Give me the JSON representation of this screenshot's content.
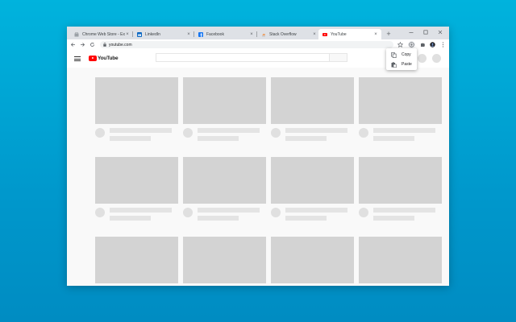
{
  "browser": {
    "tabs": [
      {
        "label": "Chrome Web Store - Exte",
        "favicon": "chrome-web-store-icon",
        "active": false
      },
      {
        "label": "LinkedIn",
        "favicon": "linkedin-icon",
        "active": false
      },
      {
        "label": "Facebook",
        "favicon": "facebook-icon",
        "active": false
      },
      {
        "label": "Stack Overflow",
        "favicon": "stack-overflow-icon",
        "active": false
      },
      {
        "label": "YouTube",
        "favicon": "youtube-icon",
        "active": true
      }
    ],
    "tab_close_glyph": "×",
    "new_tab_glyph": "+",
    "address": "youtube.com"
  },
  "extension_menu": {
    "items": [
      {
        "label": "Copy",
        "icon": "copy-icon"
      },
      {
        "label": "Paste",
        "icon": "paste-icon"
      }
    ]
  },
  "youtube": {
    "logo_text": "YouTube",
    "brand_color": "#ff0000"
  },
  "colors": {
    "desktop_top": "#00b3dd",
    "desktop_bottom": "#008cc2",
    "placeholder": "#d3d3d3"
  }
}
